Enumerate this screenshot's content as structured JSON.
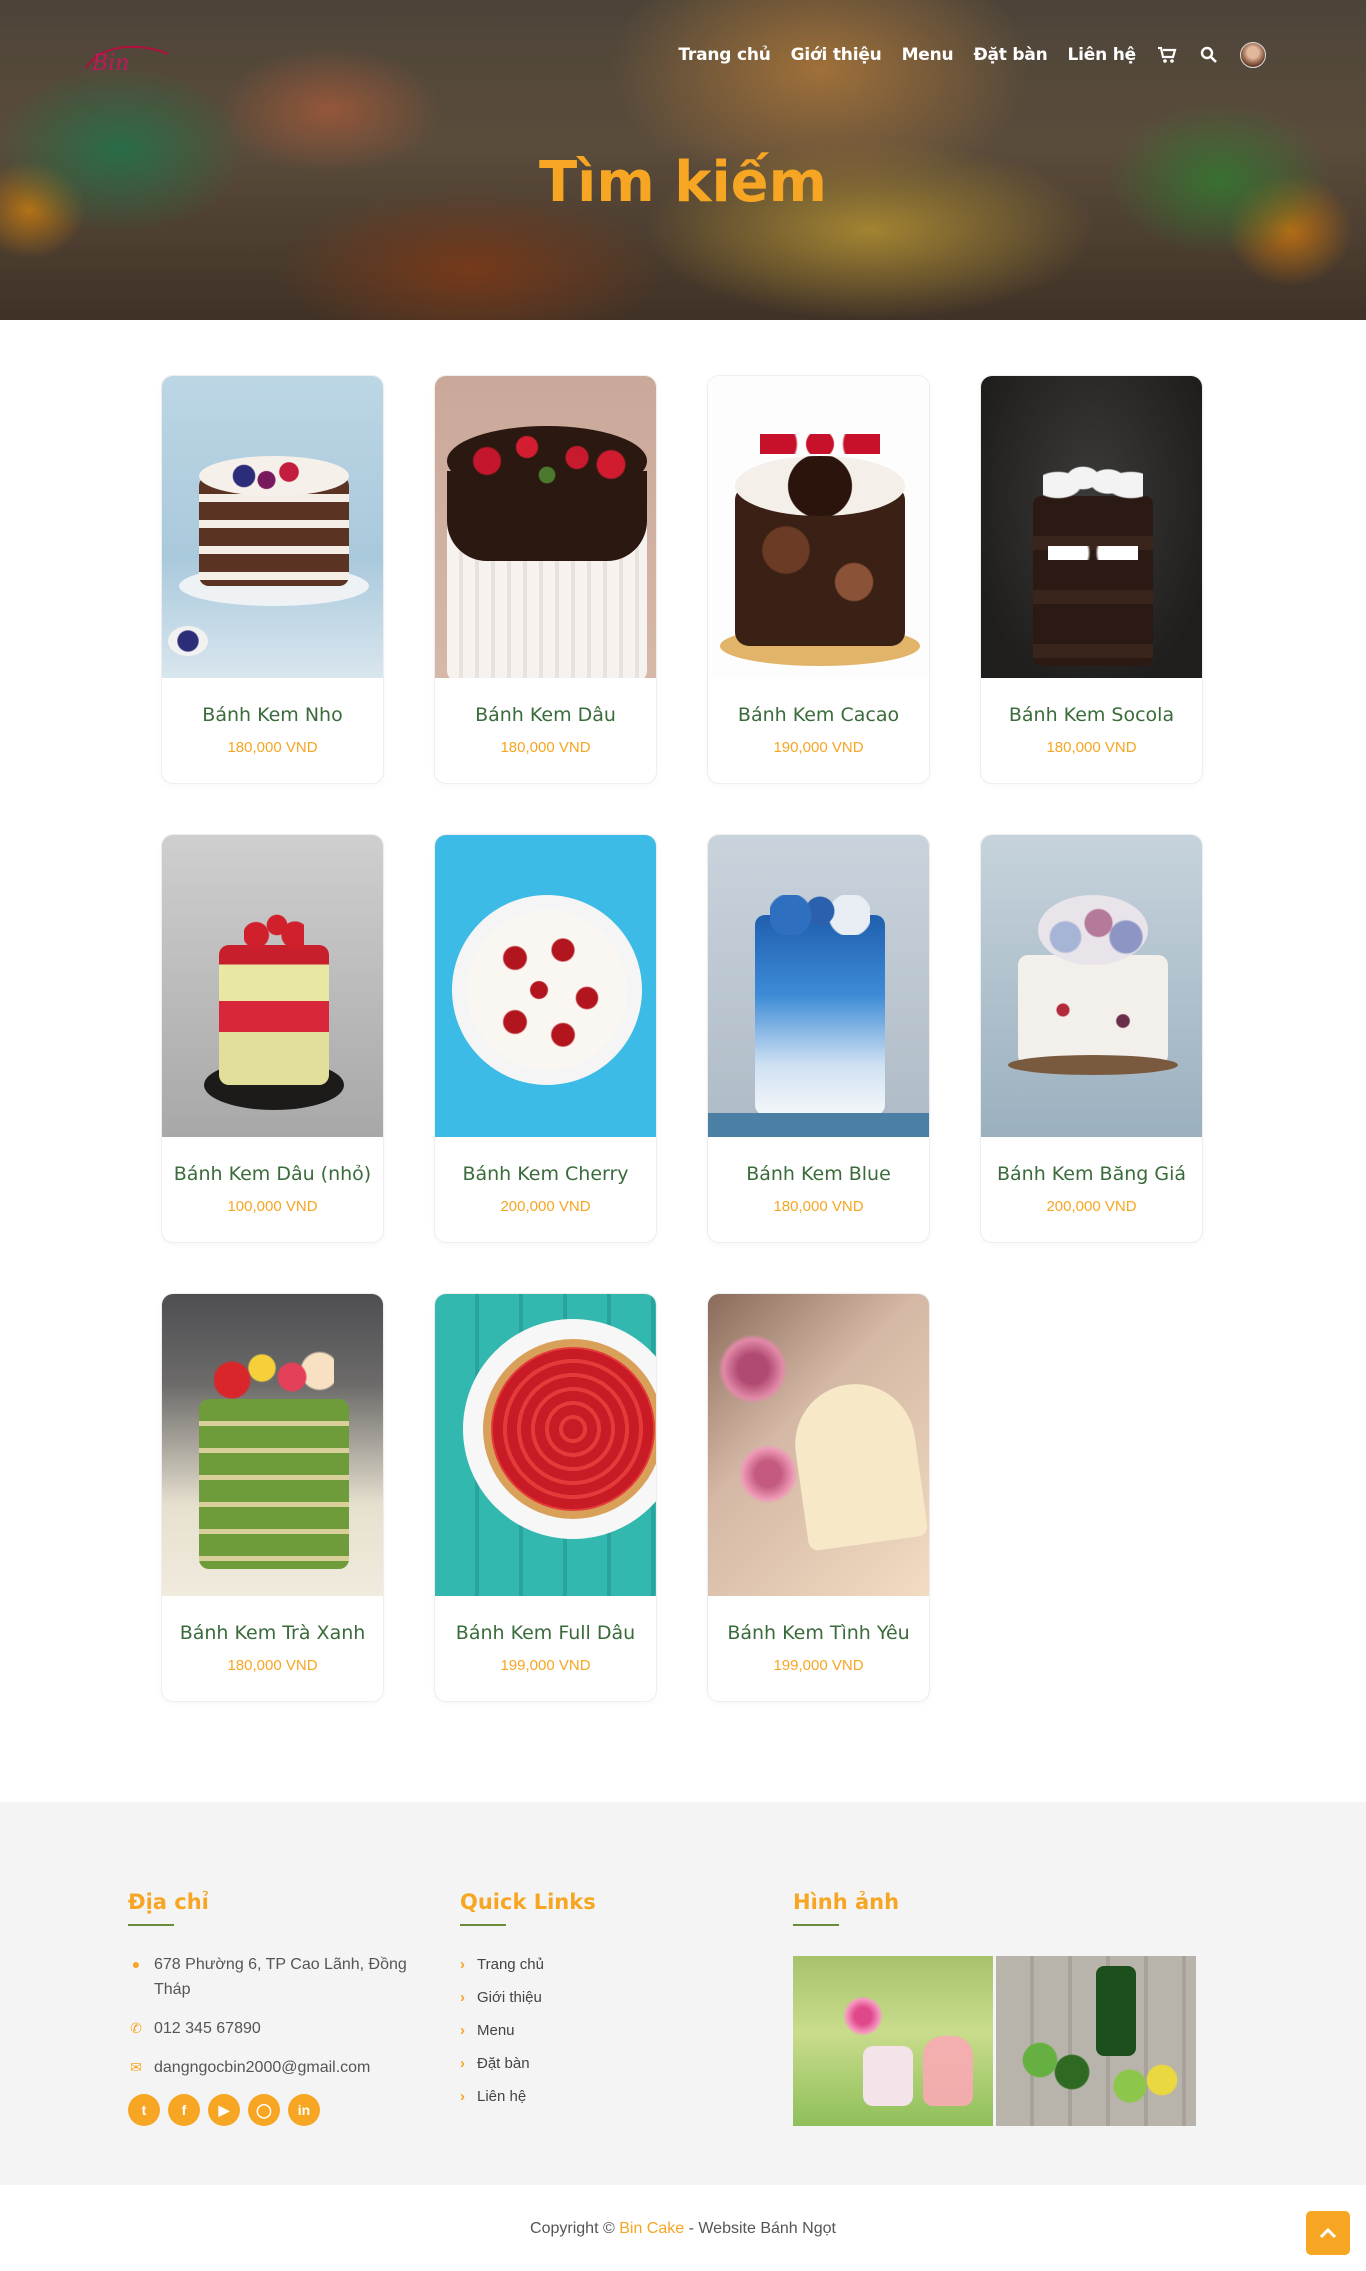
{
  "nav": {
    "logo_text": "Bin",
    "items": [
      "Trang chủ",
      "Giới thiệu",
      "Menu",
      "Đặt bàn",
      "Liên hệ"
    ]
  },
  "hero": {
    "title": "Tìm kiếm"
  },
  "products": [
    {
      "name": "Bánh Kem Nho",
      "price": "180,000 VND"
    },
    {
      "name": "Bánh Kem Dâu",
      "price": "180,000 VND"
    },
    {
      "name": "Bánh Kem Cacao",
      "price": "190,000 VND"
    },
    {
      "name": "Bánh Kem Socola",
      "price": "180,000 VND"
    },
    {
      "name": "Bánh Kem Dâu (nhỏ)",
      "price": "100,000 VND"
    },
    {
      "name": "Bánh Kem Cherry",
      "price": "200,000 VND"
    },
    {
      "name": "Bánh Kem Blue",
      "price": "180,000 VND"
    },
    {
      "name": "Bánh Kem Băng Giá",
      "price": "200,000 VND"
    },
    {
      "name": "Bánh Kem Trà Xanh",
      "price": "180,000 VND"
    },
    {
      "name": "Bánh Kem Full Dâu",
      "price": "199,000 VND"
    },
    {
      "name": "Bánh Kem Tình Yêu",
      "price": "199,000 VND"
    }
  ],
  "footer": {
    "address_title": "Địa chỉ",
    "address": "678 Phường 6, TP Cao Lãnh, Đồng Tháp",
    "phone": "012 345 67890",
    "email": "dangngocbin2000@gmail.com",
    "quick_title": "Quick Links",
    "quick_links": [
      "Trang chủ",
      "Giới thiệu",
      "Menu",
      "Đặt bàn",
      "Liên hệ"
    ],
    "images_title": "Hình ảnh",
    "copyright_prefix": "Copyright ©",
    "copyright_brand": "Bin Cake",
    "copyright_suffix": "- Website Bánh Ngọt"
  },
  "colors": {
    "accent": "#f6a623",
    "name_green": "#3a6b3a"
  },
  "icons": [
    "cart-icon",
    "search-icon",
    "map-marker-icon",
    "phone-icon",
    "envelope-icon",
    "twitter-icon",
    "facebook-icon",
    "youtube-icon",
    "instagram-icon",
    "linkedin-icon",
    "chevron-up-icon"
  ]
}
